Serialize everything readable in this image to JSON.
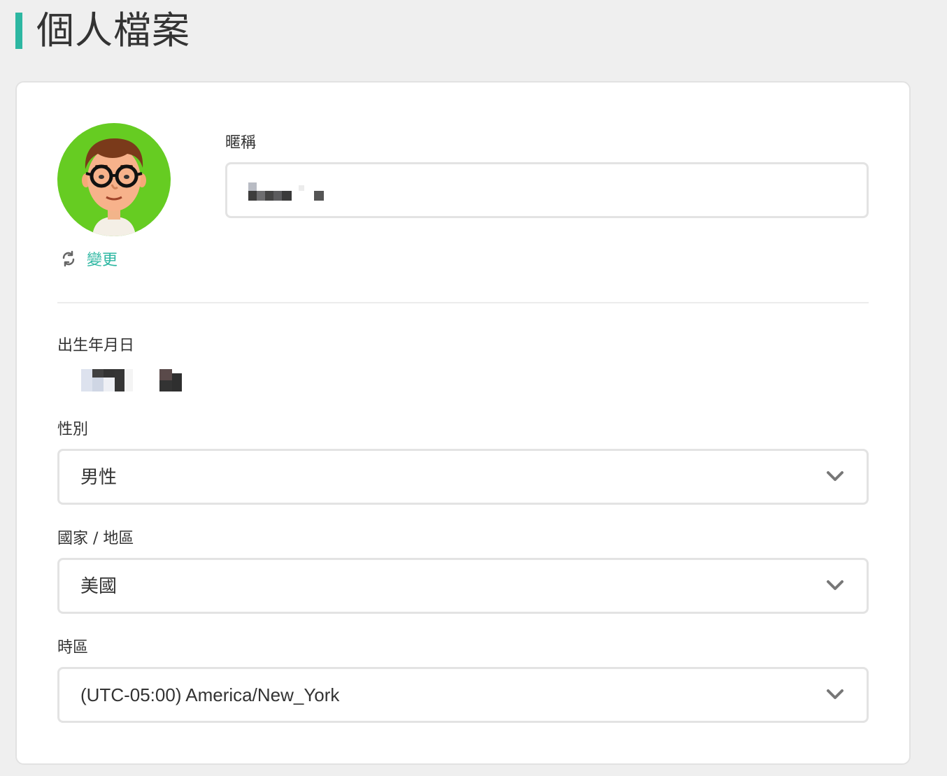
{
  "page": {
    "title": "個人檔案",
    "accent_color": "#2db7a2"
  },
  "avatar": {
    "icon": "avatar-icon",
    "background_color": "#66cc22",
    "change_label": "變更",
    "change_icon": "refresh-icon"
  },
  "nickname": {
    "label": "暱稱",
    "value": ""
  },
  "birthday": {
    "label": "出生年月日",
    "value": ""
  },
  "gender": {
    "label": "性別",
    "selected": "男性"
  },
  "country": {
    "label": "國家 / 地區",
    "selected": "美國"
  },
  "timezone": {
    "label": "時區",
    "selected": "(UTC-05:00) America/New_York"
  }
}
